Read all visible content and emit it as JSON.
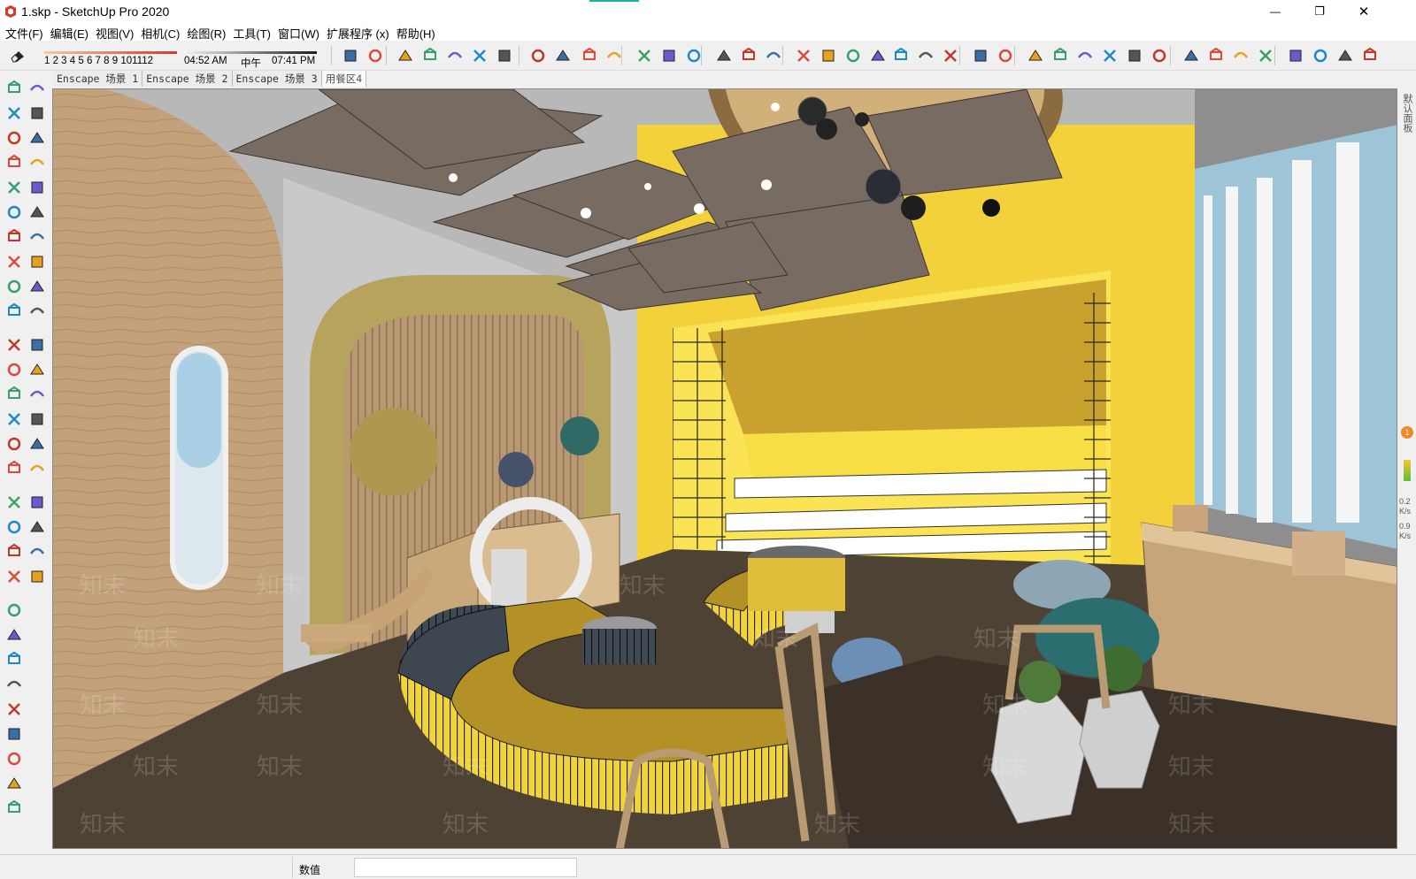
{
  "window": {
    "title": "1.skp - SketchUp Pro 2020",
    "minimize_glyph": "—",
    "restore_glyph": "❐",
    "close_glyph": "✕"
  },
  "menu": [
    {
      "label": "文件(F)",
      "name": "menu-file"
    },
    {
      "label": "编辑(E)",
      "name": "menu-edit"
    },
    {
      "label": "视图(V)",
      "name": "menu-view"
    },
    {
      "label": "相机(C)",
      "name": "menu-camera"
    },
    {
      "label": "绘图(R)",
      "name": "menu-draw"
    },
    {
      "label": "工具(T)",
      "name": "menu-tools"
    },
    {
      "label": "窗口(W)",
      "name": "menu-window"
    },
    {
      "label": "扩展程序 (x)",
      "name": "menu-extensions"
    },
    {
      "label": "帮助(H)",
      "name": "menu-help"
    }
  ],
  "shadows": {
    "month_ticks": "1 2 3 4 5 6 7 8 9 101112",
    "time_start": "04:52 AM",
    "time_mid": "中午",
    "time_end": "07:41 PM"
  },
  "scene_tabs": [
    {
      "label": "Enscape 场景 1",
      "active": false
    },
    {
      "label": "Enscape 场景 2",
      "active": false
    },
    {
      "label": "Enscape 场景 3",
      "active": false
    },
    {
      "label": "用餐区4",
      "active": true
    }
  ],
  "toolbar_icons": [
    "eraser-icon",
    "push-pull-icon",
    "paint-bucket-icon",
    "box-icon",
    "rectangle-icon",
    "x-ray-icon",
    "shaded-icon",
    "textured-icon",
    "solid-union-icon",
    "solid-subtract-icon",
    "solid-intersect-icon",
    "solid-trim-icon",
    "zoom-extents-icon",
    "component-icon",
    "refresh-icon",
    "pencil-icon",
    "dimension-icon",
    "sandbox-icon",
    "stamp-icon",
    "smoove-icon",
    "drape-icon",
    "add-detail-icon",
    "flip-edge-icon",
    "scissors-icon",
    "sweep-icon",
    "section-plane-icon",
    "section-fill-icon",
    "iso-view-icon",
    "front-view-icon",
    "home-icon",
    "right-view-icon",
    "top-view-icon",
    "back-view-icon",
    "axes-icon",
    "warehouse-icon",
    "extension-warehouse-icon",
    "layout-icon",
    "enscape-start-icon",
    "enscape-sync-icon",
    "enscape-settings-icon"
  ],
  "left_tools": [
    "select-icon",
    "make-component-icon",
    "paint-bucket-icon",
    "eraser-icon",
    "line-icon",
    "freehand-icon",
    "rectangle-icon",
    "rotated-rectangle-icon",
    "circle-icon",
    "polygon-icon",
    "arc-icon",
    "two-point-arc-icon",
    "three-point-arc-icon",
    "pie-icon",
    "move-icon",
    "push-pull-icon",
    "rotate-icon",
    "follow-me-icon",
    "scale-icon",
    "offset-icon",
    "tape-measure-icon",
    "dimension-icon",
    "protractor-icon",
    "text-icon",
    "axes-icon",
    "3d-text-icon",
    "orbit-icon",
    "pan-icon",
    "zoom-icon",
    "zoom-window-icon",
    "zoom-extents-icon",
    "previous-view-icon",
    "position-camera-icon",
    "look-around-icon",
    "walk-icon",
    "section-plane-icon",
    "warehouse-icon",
    "extension-manager-icon",
    "ruby-icon",
    "solid-tools-icon",
    "enscape-icon",
    "sync-icon",
    "video-icon",
    "add-icon",
    "tree-icon",
    "pattern-icon",
    "cloud-icon",
    "settings-icon",
    "mail-icon"
  ],
  "tray": {
    "label": "默认面板",
    "badge": "1",
    "stat1": "0.2",
    "stat1_unit": "K/s",
    "stat2": "0.9",
    "stat2_unit": "K/s"
  },
  "viewport": {
    "watermark": "知末"
  },
  "status": {
    "measurements_label": "数值",
    "measurements_value": ""
  },
  "colors": {
    "ui_bg": "#f0f0f0",
    "accent_teal": "#18b4a6",
    "wall_yellow": "#f2d13a",
    "ceiling_panel": "#7a6e64",
    "wood": "#c9a87a",
    "floor": "#4e4234"
  }
}
